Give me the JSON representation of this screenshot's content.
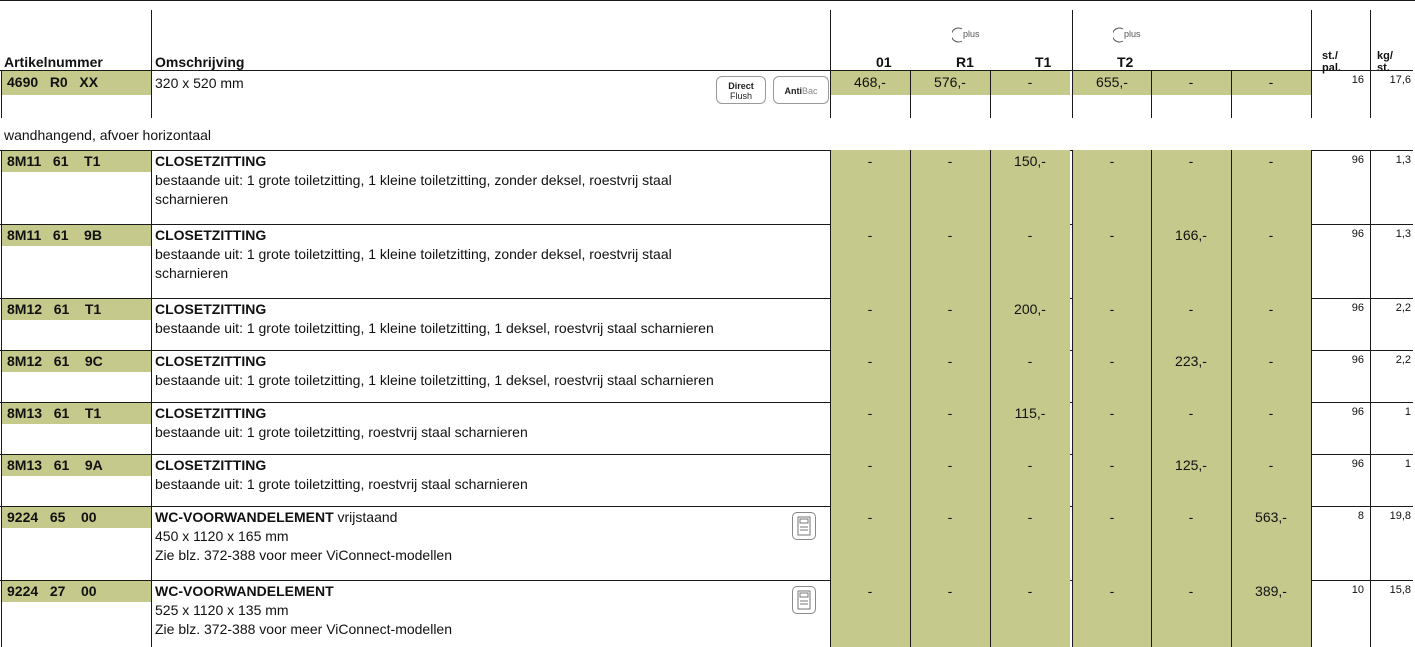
{
  "headers": {
    "artikelnummer": "Artikelnummer",
    "omschrijving": "Omschrijving",
    "c01": "01",
    "cR1": "R1",
    "cT1": "T1",
    "cT2": "T2",
    "st_pal_1": "st./",
    "st_pal_2": "pal.",
    "kg_st_1": "kg/",
    "kg_st_2": "st.",
    "plus_label": "plus"
  },
  "top_row": {
    "artikel": "4690   R0   XX",
    "desc": "320 x 520 mm",
    "badge_direct_1": "Direct",
    "badge_direct_2": "Flush",
    "badge_antibac_1": "Anti",
    "badge_antibac_2": "Bac",
    "prices": [
      "468,-",
      "576,-",
      "-",
      "655,-",
      "-",
      "-"
    ],
    "st_pal": "16",
    "kg_st": "17,6"
  },
  "section_label": "wandhangend, afvoer horizontaal",
  "rows": [
    {
      "artikel": "8M11   61    T1",
      "title": "CLOSETZITTING",
      "lines": [
        "bestaande uit: 1 grote toiletzitting, 1 kleine toiletzitting, zonder deksel, roestvrij staal",
        "scharnieren"
      ],
      "prices": [
        "-",
        "-",
        "150,-",
        "-",
        "-",
        "-"
      ],
      "st_pal": "96",
      "kg_st": "1,3"
    },
    {
      "artikel": "8M11   61    9B",
      "title": "CLOSETZITTING",
      "lines": [
        "bestaande uit: 1 grote toiletzitting, 1 kleine toiletzitting, zonder deksel, roestvrij staal",
        "scharnieren"
      ],
      "prices": [
        "-",
        "-",
        "-",
        "-",
        "166,-",
        "-"
      ],
      "st_pal": "96",
      "kg_st": "1,3"
    },
    {
      "artikel": "8M12   61    T1",
      "title": "CLOSETZITTING",
      "lines": [
        "bestaande uit: 1 grote toiletzitting, 1 kleine toiletzitting, 1 deksel, roestvrij staal scharnieren"
      ],
      "prices": [
        "-",
        "-",
        "200,-",
        "-",
        "-",
        "-"
      ],
      "st_pal": "96",
      "kg_st": "2,2"
    },
    {
      "artikel": "8M12   61    9C",
      "title": "CLOSETZITTING",
      "lines": [
        "bestaande uit: 1 grote toiletzitting, 1 kleine toiletzitting, 1 deksel, roestvrij staal scharnieren"
      ],
      "prices": [
        "-",
        "-",
        "-",
        "-",
        "223,-",
        "-"
      ],
      "st_pal": "96",
      "kg_st": "2,2"
    },
    {
      "artikel": "8M13   61    T1",
      "title": "CLOSETZITTING",
      "lines": [
        "bestaande uit: 1 grote toiletzitting, roestvrij staal scharnieren"
      ],
      "prices": [
        "-",
        "-",
        "115,-",
        "-",
        "-",
        "-"
      ],
      "st_pal": "96",
      "kg_st": "1"
    },
    {
      "artikel": "8M13   61    9A",
      "title": "CLOSETZITTING",
      "lines": [
        "bestaande uit: 1 grote toiletzitting, roestvrij staal scharnieren"
      ],
      "prices": [
        "-",
        "-",
        "-",
        "-",
        "125,-",
        "-"
      ],
      "st_pal": "96",
      "kg_st": "1"
    },
    {
      "artikel": "9224   65    00",
      "title": "WC-VOORWANDELEMENT",
      "title_suffix": " vrijstaand",
      "lines": [
        "450 x 1120 x 165 mm",
        "Zie blz. 372-388 voor meer ViConnect-modellen"
      ],
      "prices": [
        "-",
        "-",
        "-",
        "-",
        "-",
        "563,-"
      ],
      "st_pal": "8",
      "kg_st": "19,8"
    },
    {
      "artikel": "9224   27    00",
      "title": "WC-VOORWANDELEMENT",
      "lines": [
        "525 x 1120 x 135 mm",
        "Zie blz. 372-388 voor meer ViConnect-modellen"
      ],
      "prices": [
        "-",
        "-",
        "-",
        "-",
        "-",
        "389,-"
      ],
      "st_pal": "10",
      "kg_st": "15,8"
    }
  ],
  "colors": {
    "green": "#c5c98b",
    "line": "#1a1a1a"
  }
}
